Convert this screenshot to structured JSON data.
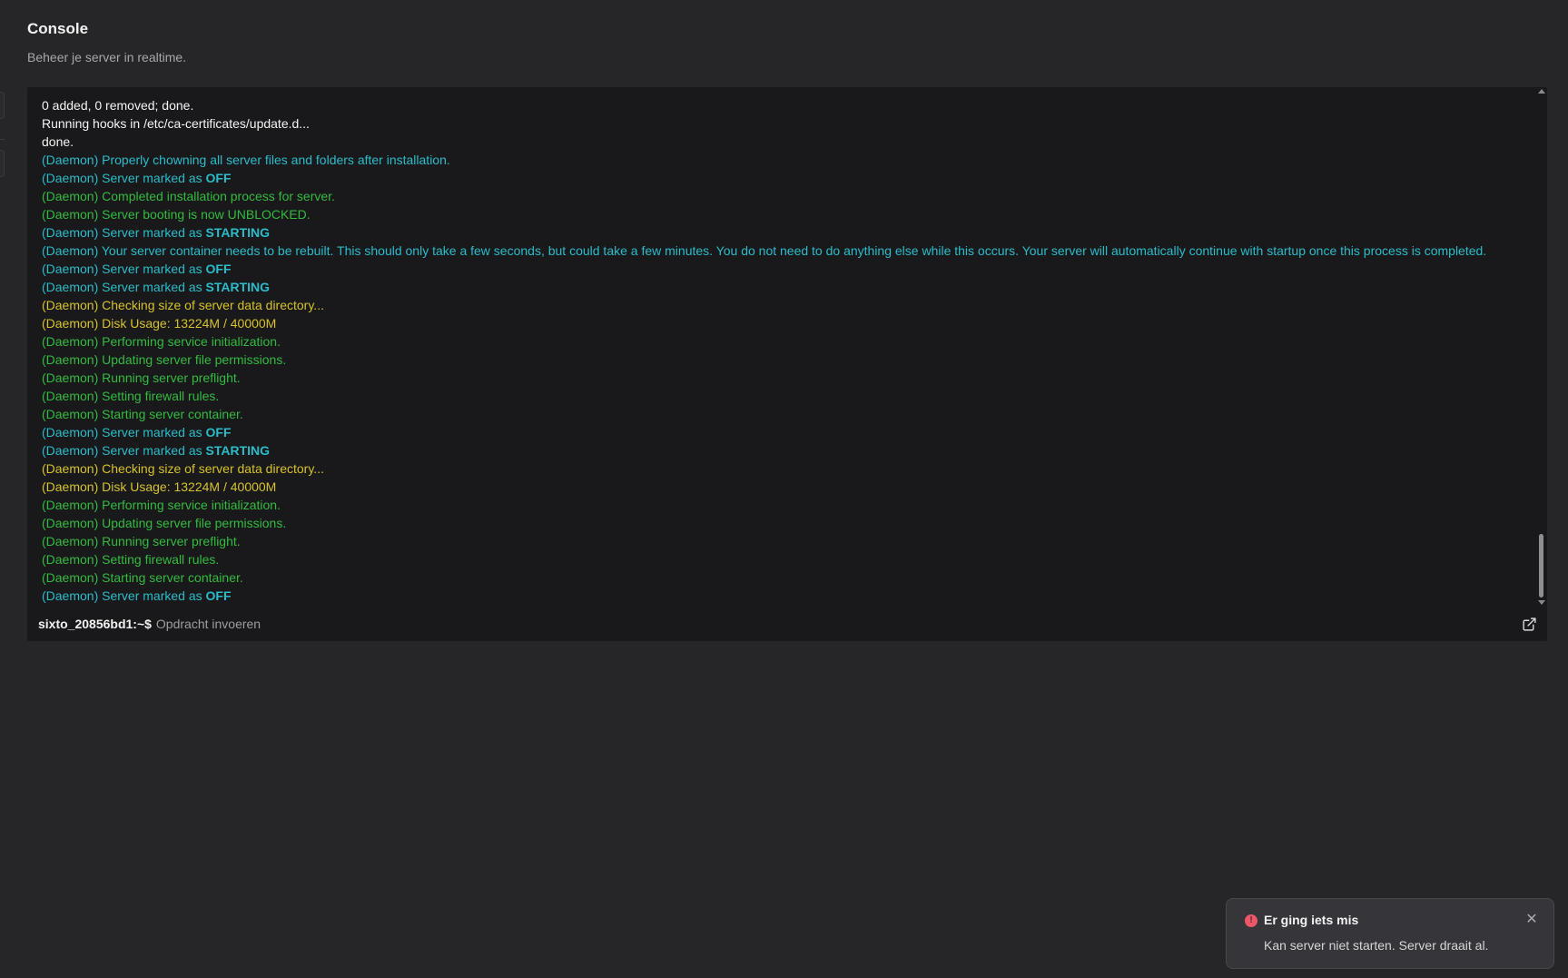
{
  "header": {
    "title": "Console",
    "subtitle": "Beheer je server in realtime."
  },
  "console": {
    "lines": [
      {
        "color": "white",
        "text": "0 added, 0 removed; done."
      },
      {
        "color": "white",
        "text": "Running hooks in /etc/ca-certificates/update.d..."
      },
      {
        "color": "white",
        "text": "done."
      },
      {
        "color": "cyan",
        "text": "(Daemon) Properly chowning all server files and folders after installation."
      },
      {
        "color": "cyan",
        "text": "(Daemon) Server marked as ",
        "bold": "OFF"
      },
      {
        "color": "green",
        "text": "(Daemon) Completed installation process for server."
      },
      {
        "color": "green",
        "text": "(Daemon) Server booting is now UNBLOCKED."
      },
      {
        "color": "cyan",
        "text": "(Daemon) Server marked as ",
        "bold": "STARTING"
      },
      {
        "color": "cyan",
        "text": "(Daemon) Your server container needs to be rebuilt. This should only take a few seconds, but could take a few minutes. You do not need to do anything else while this occurs. Your server will automatically continue with startup once this process is completed."
      },
      {
        "color": "cyan",
        "text": "(Daemon) Server marked as ",
        "bold": "OFF"
      },
      {
        "color": "cyan",
        "text": "(Daemon) Server marked as ",
        "bold": "STARTING"
      },
      {
        "color": "yellow",
        "text": "(Daemon) Checking size of server data directory..."
      },
      {
        "color": "yellow",
        "text": "(Daemon) Disk Usage: 13224M / 40000M"
      },
      {
        "color": "green",
        "text": "(Daemon) Performing service initialization."
      },
      {
        "color": "green",
        "text": "(Daemon) Updating server file permissions."
      },
      {
        "color": "green",
        "text": "(Daemon) Running server preflight."
      },
      {
        "color": "green",
        "text": "(Daemon) Setting firewall rules."
      },
      {
        "color": "green",
        "text": "(Daemon) Starting server container."
      },
      {
        "color": "cyan",
        "text": "(Daemon) Server marked as ",
        "bold": "OFF"
      },
      {
        "color": "cyan",
        "text": "(Daemon) Server marked as ",
        "bold": "STARTING"
      },
      {
        "color": "yellow",
        "text": "(Daemon) Checking size of server data directory..."
      },
      {
        "color": "yellow",
        "text": "(Daemon) Disk Usage: 13224M / 40000M"
      },
      {
        "color": "green",
        "text": "(Daemon) Performing service initialization."
      },
      {
        "color": "green",
        "text": "(Daemon) Updating server file permissions."
      },
      {
        "color": "green",
        "text": "(Daemon) Running server preflight."
      },
      {
        "color": "green",
        "text": "(Daemon) Setting firewall rules."
      },
      {
        "color": "green",
        "text": "(Daemon) Starting server container."
      },
      {
        "color": "cyan",
        "text": "(Daemon) Server marked as ",
        "bold": "OFF"
      }
    ],
    "prompt": "sixto_20856bd1:~$",
    "input_placeholder": "Opdracht invoeren",
    "input_value": "",
    "popout_icon": "external-link-icon"
  },
  "toast": {
    "icon": "error-icon",
    "title": "Er ging iets mis",
    "message": "Kan server niet starten. Server draait al.",
    "close_icon": "close-icon"
  },
  "colors": {
    "background": "#262628",
    "console_background": "#19191b",
    "log_white": "#f4f4f4",
    "log_cyan": "#2bbcca",
    "log_green": "#33bb3f",
    "log_yellow": "#d6c22a",
    "error": "#f0566a"
  }
}
